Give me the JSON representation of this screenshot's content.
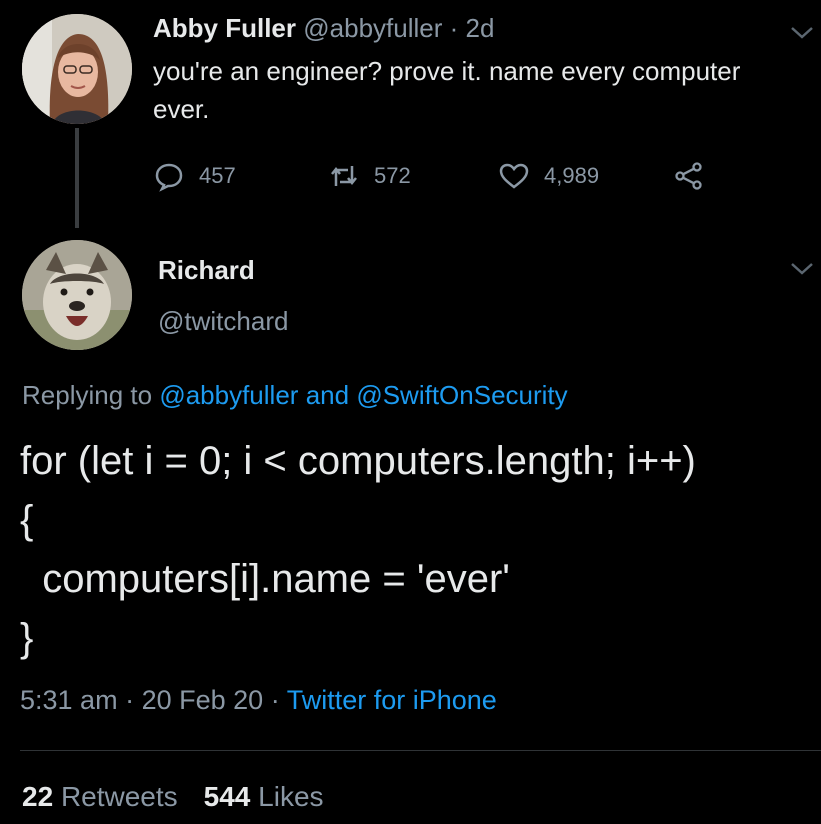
{
  "parent_tweet": {
    "author_name": "Abby Fuller",
    "author_handle": "@abbyfuller",
    "separator": "·",
    "age": "2d",
    "text": "you're an engineer? prove it. name every computer ever.",
    "replies": "457",
    "retweets": "572",
    "likes": "4,989"
  },
  "reply_tweet": {
    "author_name": "Richard",
    "author_handle": "@twitchard",
    "replying_prefix": "Replying to",
    "replying_user_1": "@abbyfuller",
    "replying_and": "and",
    "replying_user_2": "@SwiftOnSecurity",
    "body": "for (let i = 0; i < computers.length; i++)\n{\n  computers[i].name = 'ever'\n}",
    "time": "5:31 am",
    "date": "20 Feb 20",
    "source": "Twitter for iPhone",
    "meta_separator": "·",
    "retweet_count": "22",
    "retweet_label": "Retweets",
    "like_count": "544",
    "like_label": "Likes"
  },
  "icons": {
    "reply": "reply-icon",
    "retweet": "retweet-icon",
    "like": "heart-icon",
    "share": "share-icon",
    "menu": "chevron-down-icon"
  },
  "colors": {
    "background": "#000000",
    "text": "#e7e9ea",
    "muted": "#8b98a5",
    "link": "#1d9bf0"
  }
}
